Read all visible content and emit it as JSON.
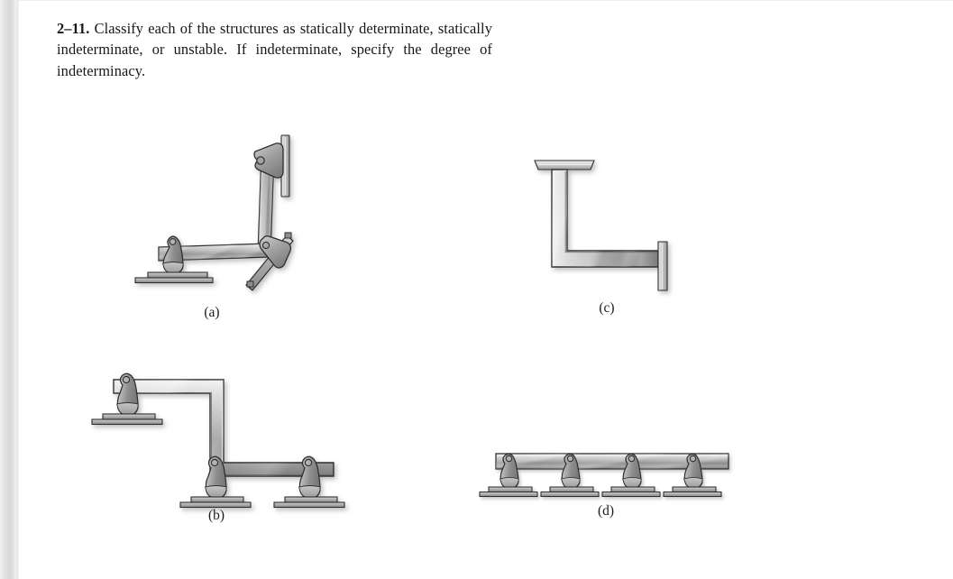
{
  "document": {
    "type": "textbook-problem-page",
    "background_color": "#ffffff",
    "gutter_color": "#dcdcdc"
  },
  "statement": {
    "problem_number": "2–11.",
    "text": "Classify each of the structures as statically determinate, statically indeterminate, or unstable. If indeterminate, specify the degree of indeterminacy.",
    "full_text": "2–11. Classify each of the structures as statically determinate, statically indeterminate, or unstable. If indeterminate, specify the degree of indeterminacy."
  },
  "figure": {
    "panels": [
      {
        "id": "a",
        "caption": "(a)",
        "description": "Bent frame with vertical member pinned to a vertical wall plate at top, horizontal member on a pin support at left, and a pin support on a 45-degree inclined surface at the corner joint.",
        "supports": [
          "pin-on-base-plate",
          "pin-to-wall-plate",
          "pin-on-inclined-surface"
        ],
        "support_count": 3
      },
      {
        "id": "b",
        "caption": "(b)",
        "description": "Z-shaped frame with three pin supports: one under the upper-left horizontal member, one under the corner of the lower horizontal member, and one at the right end of the lower horizontal member.",
        "supports": [
          "pin-on-base-plate",
          "pin-on-base-plate",
          "pin-on-base-plate"
        ],
        "support_count": 3
      },
      {
        "id": "c",
        "caption": "(c)",
        "description": "L-shaped frame fixed to a horizontal ceiling plate at the top of the vertical member and fixed to a vertical wall plate at the right end of the horizontal member.",
        "supports": [
          "fixed-to-ceiling-plate",
          "fixed-to-wall-plate"
        ],
        "support_count": 2
      },
      {
        "id": "d",
        "caption": "(d)",
        "description": "Continuous horizontal beam resting on four pin supports spaced evenly along its length.",
        "supports": [
          "pin-on-base-plate",
          "pin-on-base-plate",
          "pin-on-base-plate",
          "pin-on-base-plate"
        ],
        "support_count": 4
      }
    ]
  },
  "colors": {
    "beam_light": "#e9e9e9",
    "beam_mid": "#a8a8a8",
    "beam_dark": "#6f6f6f",
    "outline": "#2e2e2e",
    "support_fill": "#9a9a9a",
    "plate_fill": "#b4b4b4",
    "shadow": "#c9c9c9",
    "text": "#171717",
    "page": "#ffffff"
  }
}
